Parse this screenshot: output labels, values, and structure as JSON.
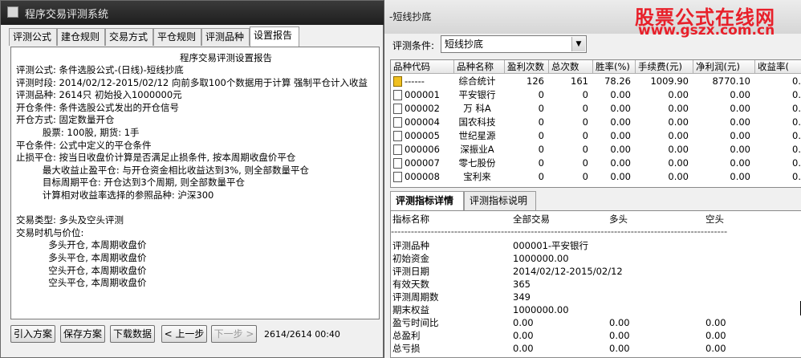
{
  "left_window": {
    "title": "程序交易评测系统",
    "tabs": [
      "评测公式",
      "建仓规则",
      "交易方式",
      "平仓规则",
      "评测品种",
      "设置报告"
    ],
    "report_title": "程序交易评测设置报告",
    "report_lines": [
      "评测公式: 条件选股公式-(日线)-短线抄底",
      "评测时段: 2014/02/12-2015/02/12 向前多取100个数据用于计算 强制平仓计入收益",
      "评测品种: 2614只 初始投入1000000元",
      "开仓条件: 条件选股公式发出的开仓信号",
      "开仓方式: 固定数量开仓",
      "         股票: 100股, 期货: 1手",
      "平仓条件: 公式中定义的平仓条件",
      "止损平仓: 按当日收盘价计算是否满足止损条件, 按本周期收盘价平仓",
      "         最大收益止盈平仓: 与开仓资金相比收益达到3%, 则全部数量平仓",
      "         目标周期平仓: 开仓达到3个周期, 则全部数量平仓",
      "         计算相对收益率选择的参照品种: 沪深300",
      "",
      "交易类型: 多头及空头评测",
      "交易时机与价位:",
      "           多头开仓, 本周期收盘价",
      "           多头平仓, 本周期收盘价",
      "           空头开仓, 本周期收盘价",
      "           空头平仓, 本周期收盘价"
    ],
    "buttons": {
      "import": "引入方案",
      "save": "保存方案",
      "download": "下载数据",
      "prev": "< 上一步",
      "next": "下一步 >"
    },
    "status": "2614/2614 00:40"
  },
  "right_window": {
    "title": "-短线抄底",
    "logo_line1": "股票公式在线网",
    "logo_line2": "www.gszx.com.cn",
    "condition_label": "评测条件:",
    "condition_value": "短线抄底",
    "columns": [
      "品种代码",
      "品种名称",
      "盈利次数",
      "总次数",
      "胜率(%)",
      "手续费(元)",
      "净利润(元)",
      "收益率("
    ],
    "rows": [
      {
        "code": "------",
        "name": "综合统计",
        "win": "126",
        "total": "161",
        "rate": "78.26",
        "fee": "1009.90",
        "profit": "8770.10",
        "yield": "0.",
        "icon": "folder"
      },
      {
        "code": "000001",
        "name": "平安银行",
        "win": "0",
        "total": "0",
        "rate": "0.00",
        "fee": "0.00",
        "profit": "0.00",
        "yield": "0.",
        "icon": "doc"
      },
      {
        "code": "000002",
        "name": "万  科A",
        "win": "0",
        "total": "0",
        "rate": "0.00",
        "fee": "0.00",
        "profit": "0.00",
        "yield": "0.",
        "icon": "doc"
      },
      {
        "code": "000004",
        "name": "国农科技",
        "win": "0",
        "total": "0",
        "rate": "0.00",
        "fee": "0.00",
        "profit": "0.00",
        "yield": "0.",
        "icon": "doc"
      },
      {
        "code": "000005",
        "name": "世纪星源",
        "win": "0",
        "total": "0",
        "rate": "0.00",
        "fee": "0.00",
        "profit": "0.00",
        "yield": "0.",
        "icon": "doc"
      },
      {
        "code": "000006",
        "name": "深振业A",
        "win": "0",
        "total": "0",
        "rate": "0.00",
        "fee": "0.00",
        "profit": "0.00",
        "yield": "0.",
        "icon": "doc"
      },
      {
        "code": "000007",
        "name": "零七股份",
        "win": "0",
        "total": "0",
        "rate": "0.00",
        "fee": "0.00",
        "profit": "0.00",
        "yield": "0.",
        "icon": "doc"
      },
      {
        "code": "000008",
        "name": "宝利来",
        "win": "0",
        "total": "0",
        "rate": "0.00",
        "fee": "0.00",
        "profit": "0.00",
        "yield": "0.",
        "icon": "doc"
      }
    ],
    "detail_tabs": [
      "评测指标详情",
      "评测指标说明"
    ],
    "detail_header": [
      "指标名称",
      "全部交易",
      "多头",
      "空头"
    ],
    "detail_separator": "-----------------------------------------------------------------------------------------------------",
    "detail_rows": [
      {
        "name": "评测品种",
        "all": "000001-平安银行",
        "long": "",
        "short": ""
      },
      {
        "name": "初始资金",
        "all": "1000000.00",
        "long": "",
        "short": ""
      },
      {
        "name": "评测日期",
        "all": "2014/02/12-2015/02/12",
        "long": "",
        "short": ""
      },
      {
        "name": "有效天数",
        "all": "365",
        "long": "",
        "short": ""
      },
      {
        "name": "评测周期数",
        "all": "349",
        "long": "",
        "short": ""
      },
      {
        "name": "期末权益",
        "all": "1000000.00",
        "long": "",
        "short": ""
      },
      {
        "name": "盈亏时间比",
        "all": "0.00",
        "long": "0.00",
        "short": "0.00"
      },
      {
        "name": "总盈利",
        "all": "0.00",
        "long": "0.00",
        "short": "0.00"
      },
      {
        "name": "总亏损",
        "all": "0.00",
        "long": "0.00",
        "short": "0.00"
      }
    ]
  }
}
